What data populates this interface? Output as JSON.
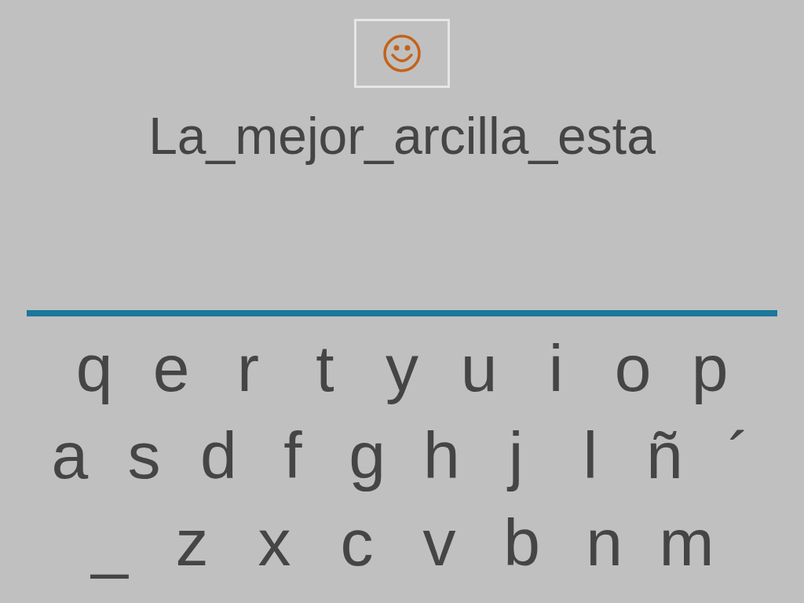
{
  "feedback": {
    "kind": "smiley"
  },
  "phrase": "La_mejor_arcilla_esta",
  "keyboard": {
    "rows": [
      [
        "q",
        "e",
        "r",
        "t",
        "y",
        "u",
        "i",
        "o",
        "p"
      ],
      [
        "a",
        "s",
        "d",
        "f",
        "g",
        "h",
        "j",
        "l",
        "ñ",
        "´"
      ],
      [
        "_",
        "z",
        "x",
        "c",
        "v",
        "b",
        "n",
        "m"
      ]
    ]
  }
}
